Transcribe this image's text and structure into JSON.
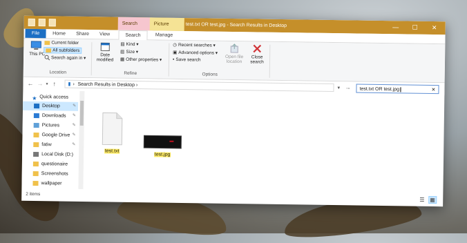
{
  "window": {
    "title": "test.txt OR test.jpg - Search Results in Desktop",
    "context_tabs": {
      "search_tools": "Search Tools",
      "picture_tools": "Picture Tools"
    },
    "controls": {
      "minimize": "—",
      "maximize": "☐",
      "close": "✕"
    }
  },
  "ribbon_tabs": [
    "File",
    "Home",
    "Share",
    "View",
    "Search",
    "Manage"
  ],
  "ribbon": {
    "location": {
      "this_pc": "This PC",
      "current_folder": "Current folder",
      "all_subfolders": "All subfolders",
      "search_again": "Search again in",
      "label": "Location"
    },
    "refine": {
      "date_modified": "Date modified",
      "kind": "Kind",
      "size": "Size",
      "other_properties": "Other properties",
      "label": "Refine"
    },
    "options": {
      "recent_searches": "Recent searches",
      "advanced_options": "Advanced options",
      "save_search": "Save search",
      "open_file_location": "Open file location",
      "close_search": "Close search",
      "label": "Options"
    }
  },
  "address": {
    "breadcrumb": "Search Results in Desktop",
    "search_value": "test.txt OR test.jpg"
  },
  "nav": [
    {
      "label": "Quick access",
      "icon": "star-icon",
      "pinned": false
    },
    {
      "label": "Desktop",
      "icon": "desktop-icon",
      "pinned": true
    },
    {
      "label": "Downloads",
      "icon": "download-icon",
      "pinned": true
    },
    {
      "label": "Pictures",
      "icon": "pictures-icon",
      "pinned": true
    },
    {
      "label": "Google Drive",
      "icon": "folder-icon",
      "pinned": true
    },
    {
      "label": "fatiw",
      "icon": "folder-icon",
      "pinned": true
    },
    {
      "label": "Local Disk (D:)",
      "icon": "drive-icon",
      "pinned": false
    },
    {
      "label": "questionaire",
      "icon": "folder-icon",
      "pinned": false
    },
    {
      "label": "Screenshots",
      "icon": "folder-icon",
      "pinned": false
    },
    {
      "label": "wallpaper",
      "icon": "folder-icon",
      "pinned": false
    }
  ],
  "files": [
    {
      "name": "test.txt",
      "type": "text-file-icon"
    },
    {
      "name": "test.jpg",
      "type": "image-file-icon"
    }
  ],
  "status": {
    "count": "2 items"
  },
  "colors": {
    "titlebar": "#c58f2a",
    "file_tab": "#1c6fc4",
    "selected_nav": "#cce8ff",
    "highlight": "#ffeb63"
  }
}
